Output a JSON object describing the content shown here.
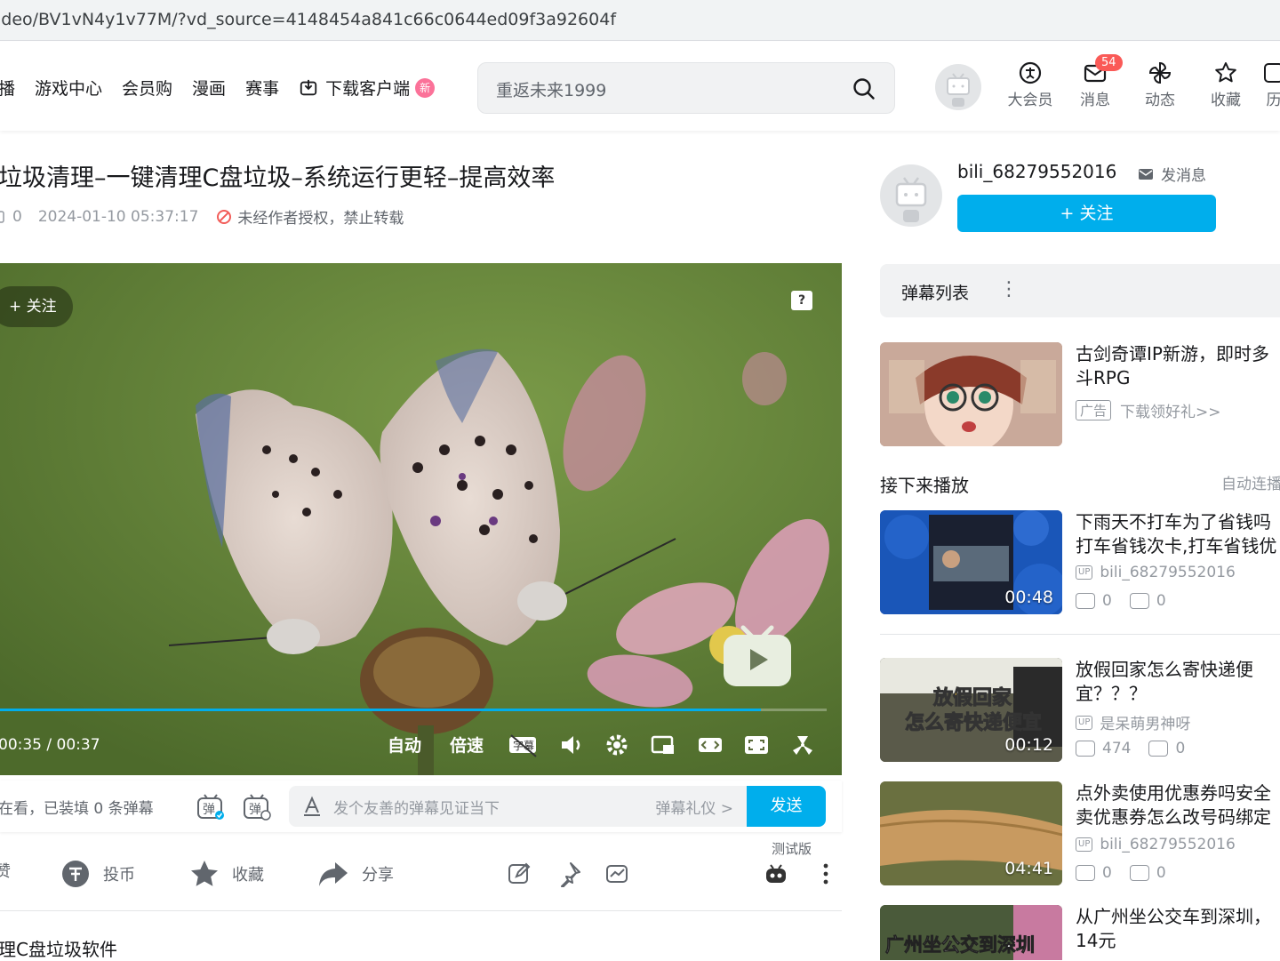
{
  "browser": {
    "url": "ideo/BV1vN4y1v77M/?vd_source=4148454a841c66c0644ed09f3a92604f"
  },
  "nav": {
    "items": [
      "播",
      "游戏中心",
      "会员购",
      "漫画",
      "赛事"
    ],
    "download_label": "下载客户端",
    "new_badge": "新"
  },
  "search": {
    "placeholder": "重返未来1999"
  },
  "header_icons": {
    "vip": "大会员",
    "messages": "消息",
    "messages_badge": "54",
    "dynamics": "动态",
    "favorites": "收藏",
    "history_partial": "历"
  },
  "video": {
    "title": "垃圾清理–一键清理C盘垃圾–系统运行更轻–提高效率",
    "danmaku_count": "0",
    "date": "2024-01-10 05:37:17",
    "no_repost": "未经作者授权，禁止转载"
  },
  "player": {
    "follow_label": "关注",
    "time_current": "00:35",
    "time_total": "00:37",
    "progress": 0.92,
    "auto_label": "自动",
    "speed_label": "倍速",
    "cc_label": "字幕"
  },
  "danmaku_bar": {
    "status": "在看，已装填 0 条弹幕",
    "placeholder": "发个友善的弹幕见证当下",
    "etiquette": "弹幕礼仪 >",
    "send": "发送"
  },
  "test_label": "测试版",
  "actions": {
    "like_partial": "赞",
    "coin": "投币",
    "favorite": "收藏",
    "share": "分享"
  },
  "tag_partial": "理C盘垃圾软件",
  "uploader": {
    "name": "bili_68279552016",
    "send_message": "发消息",
    "follow": "+ 关注"
  },
  "danmaku_list": {
    "title": "弹幕列表",
    "menu": "⋮"
  },
  "ad": {
    "title_line1": "古剑奇谭IP新游，即时多",
    "title_line2": "斗RPG",
    "ad_tag": "广告",
    "cta": "下载领好礼>>"
  },
  "next_up": {
    "title": "接下来播放",
    "autoplay": "自动连播"
  },
  "recommendations": [
    {
      "title_line1": "下雨天不打车为了省钱吗",
      "title_line2": "打车省钱次卡,打车省钱优",
      "author": "bili_68279552016",
      "views": "0",
      "danmaku": "0",
      "duration": "00:48"
    },
    {
      "title_line1": "放假回家怎么寄快递便",
      "title_line2": "宜？？？",
      "author": "是呆萌男神呀",
      "views": "474",
      "danmaku": "0",
      "duration": "00:12",
      "thumb_text_1": "放假回家",
      "thumb_text_2": "怎么寄快递便宜"
    },
    {
      "title_line1": "点外卖使用优惠券吗安全",
      "title_line2": "卖优惠券怎么改号码绑定",
      "author": "bili_68279552016",
      "views": "0",
      "danmaku": "0",
      "duration": "04:41"
    },
    {
      "title_line1": "从广州坐公交车到深圳，",
      "title_line2": "14元",
      "thumb_text": "广州坐公交到深圳"
    }
  ],
  "colors": {
    "accent": "#00aeec",
    "pink": "#fb7299",
    "badge": "#fa5a57"
  }
}
